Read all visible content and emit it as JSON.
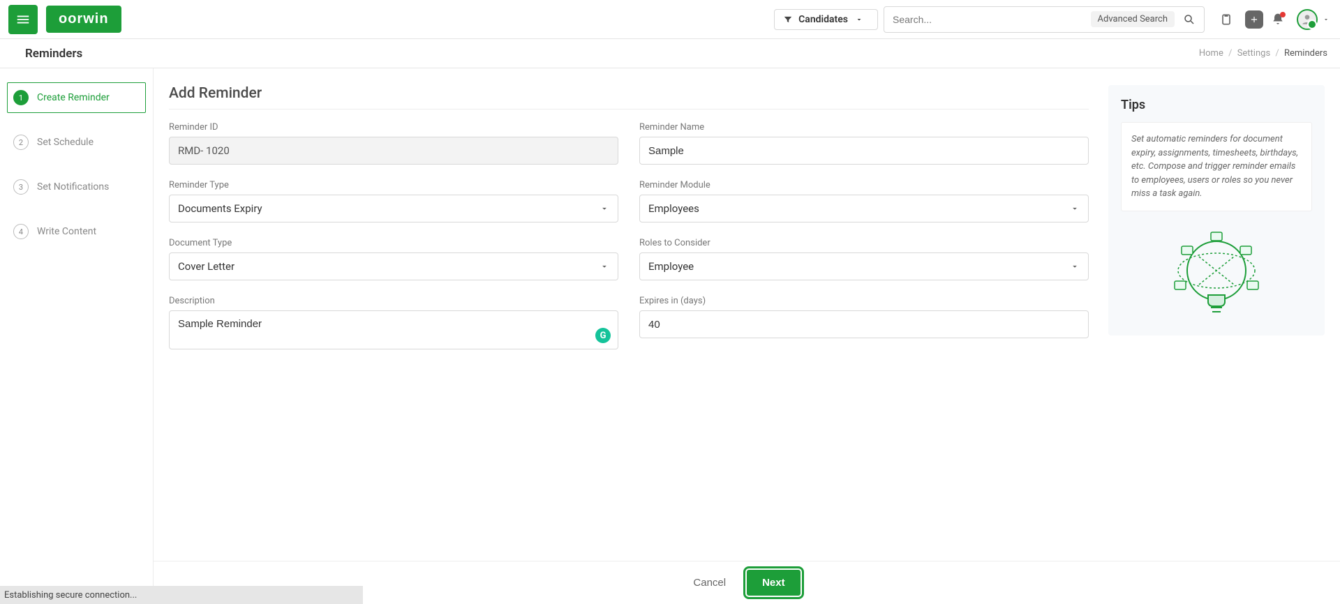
{
  "topbar": {
    "logo_text": "oorwin",
    "filter_label": "Candidates",
    "search_placeholder": "Search...",
    "advanced_search_label": "Advanced Search"
  },
  "subheader": {
    "title": "Reminders"
  },
  "breadcrumb": {
    "home": "Home",
    "settings": "Settings",
    "current": "Reminders"
  },
  "steps": [
    {
      "num": "1",
      "label": "Create Reminder",
      "active": true
    },
    {
      "num": "2",
      "label": "Set Schedule",
      "active": false
    },
    {
      "num": "3",
      "label": "Set Notifications",
      "active": false
    },
    {
      "num": "4",
      "label": "Write Content",
      "active": false
    }
  ],
  "form": {
    "heading": "Add Reminder",
    "reminder_id_label": "Reminder ID",
    "reminder_id_value": "RMD- 1020",
    "reminder_name_label": "Reminder Name",
    "reminder_name_value": "Sample",
    "reminder_type_label": "Reminder Type",
    "reminder_type_value": "Documents Expiry",
    "reminder_module_label": "Reminder Module",
    "reminder_module_value": "Employees",
    "document_type_label": "Document Type",
    "document_type_value": "Cover Letter",
    "roles_label": "Roles to Consider",
    "roles_value": "Employee",
    "description_label": "Description",
    "description_value": "Sample Reminder",
    "expires_label": "Expires in (days)",
    "expires_value": "40"
  },
  "tips": {
    "heading": "Tips",
    "body": "Set automatic reminders for document expiry, assignments, timesheets, birthdays, etc. Compose and trigger reminder emails to employees, users or roles so you never miss a task again."
  },
  "footer": {
    "cancel": "Cancel",
    "next": "Next"
  },
  "status": "Establishing secure connection..."
}
